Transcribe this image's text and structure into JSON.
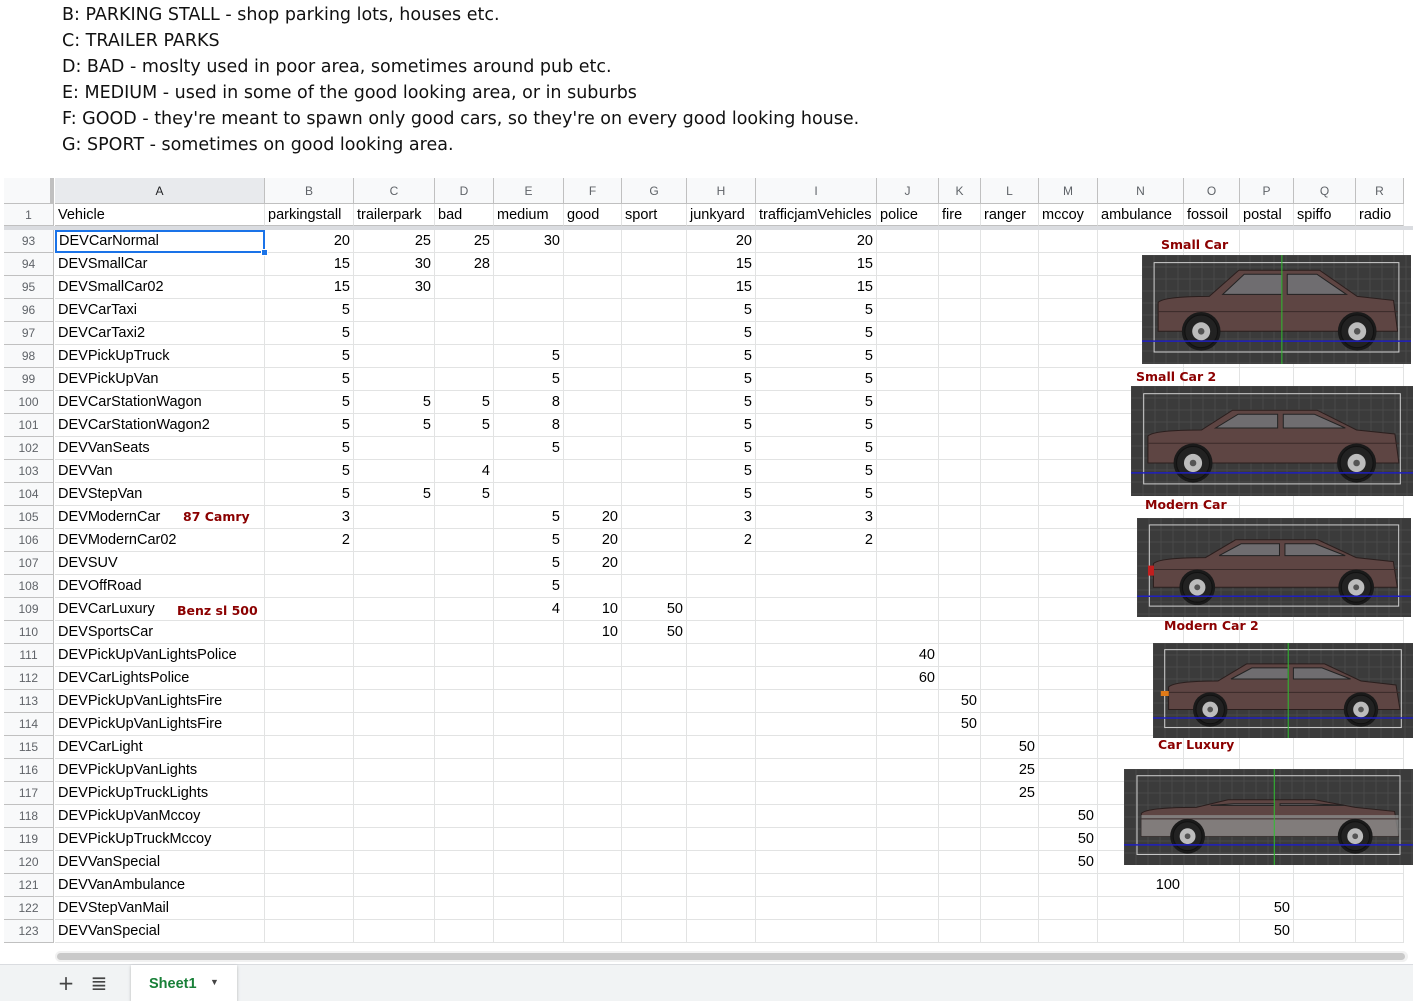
{
  "notes": [
    "B: PARKING STALL - shop parking lots, houses etc.",
    "C: TRAILER PARKS",
    "D: BAD - moslty used in poor area, sometimes around pub etc.",
    "E: MEDIUM - used in some of the good looking area, or in suburbs",
    "F: GOOD - they're meant to spawn only good cars, so they're on every good looking house.",
    "G: SPORT - sometimes on good looking area."
  ],
  "columns": [
    "A",
    "B",
    "C",
    "D",
    "E",
    "F",
    "G",
    "H",
    "I",
    "J",
    "K",
    "L",
    "M",
    "N",
    "O",
    "P",
    "Q",
    "R"
  ],
  "header_row": {
    "number": "1",
    "cells": [
      "Vehicle",
      "parkingstall",
      "trailerpark",
      "bad",
      "medium",
      "good",
      "sport",
      "junkyard",
      "trafficjamVehicles",
      "police",
      "fire",
      "ranger",
      "mccoy",
      "ambulance",
      "fossoil",
      "postal",
      "spiffo",
      "radio"
    ]
  },
  "rows": [
    {
      "n": "93",
      "cells": [
        "DEVCarNormal",
        "20",
        "25",
        "25",
        "30",
        "",
        "",
        "20",
        "20",
        "",
        "",
        "",
        "",
        "",
        "",
        "",
        "",
        ""
      ]
    },
    {
      "n": "94",
      "cells": [
        "DEVSmallCar",
        "15",
        "30",
        "28",
        "",
        "",
        "",
        "15",
        "15",
        "",
        "",
        "",
        "",
        "",
        "",
        "",
        "",
        ""
      ]
    },
    {
      "n": "95",
      "cells": [
        "DEVSmallCar02",
        "15",
        "30",
        "",
        "",
        "",
        "",
        "15",
        "15",
        "",
        "",
        "",
        "",
        "",
        "",
        "",
        "",
        ""
      ]
    },
    {
      "n": "96",
      "cells": [
        "DEVCarTaxi",
        "5",
        "",
        "",
        "",
        "",
        "",
        "5",
        "5",
        "",
        "",
        "",
        "",
        "",
        "",
        "",
        "",
        ""
      ]
    },
    {
      "n": "97",
      "cells": [
        "DEVCarTaxi2",
        "5",
        "",
        "",
        "",
        "",
        "",
        "5",
        "5",
        "",
        "",
        "",
        "",
        "",
        "",
        "",
        "",
        ""
      ]
    },
    {
      "n": "98",
      "cells": [
        "DEVPickUpTruck",
        "5",
        "",
        "",
        "5",
        "",
        "",
        "5",
        "5",
        "",
        "",
        "",
        "",
        "",
        "",
        "",
        "",
        ""
      ]
    },
    {
      "n": "99",
      "cells": [
        "DEVPickUpVan",
        "5",
        "",
        "",
        "5",
        "",
        "",
        "5",
        "5",
        "",
        "",
        "",
        "",
        "",
        "",
        "",
        "",
        ""
      ]
    },
    {
      "n": "100",
      "cells": [
        "DEVCarStationWagon",
        "5",
        "5",
        "5",
        "8",
        "",
        "",
        "5",
        "5",
        "",
        "",
        "",
        "",
        "",
        "",
        "",
        "",
        ""
      ]
    },
    {
      "n": "101",
      "cells": [
        "DEVCarStationWagon2",
        "5",
        "5",
        "5",
        "8",
        "",
        "",
        "5",
        "5",
        "",
        "",
        "",
        "",
        "",
        "",
        "",
        "",
        ""
      ]
    },
    {
      "n": "102",
      "cells": [
        "DEVVanSeats",
        "5",
        "",
        "",
        "5",
        "",
        "",
        "5",
        "5",
        "",
        "",
        "",
        "",
        "",
        "",
        "",
        "",
        ""
      ]
    },
    {
      "n": "103",
      "cells": [
        "DEVVan",
        "5",
        "",
        "4",
        "",
        "",
        "",
        "5",
        "5",
        "",
        "",
        "",
        "",
        "",
        "",
        "",
        "",
        ""
      ]
    },
    {
      "n": "104",
      "cells": [
        "DEVStepVan",
        "5",
        "5",
        "5",
        "",
        "",
        "",
        "5",
        "5",
        "",
        "",
        "",
        "",
        "",
        "",
        "",
        "",
        ""
      ]
    },
    {
      "n": "105",
      "cells": [
        "DEVModernCar",
        "3",
        "",
        "",
        "5",
        "20",
        "",
        "3",
        "3",
        "",
        "",
        "",
        "",
        "",
        "",
        "",
        "",
        ""
      ]
    },
    {
      "n": "106",
      "cells": [
        "DEVModernCar02",
        "2",
        "",
        "",
        "5",
        "20",
        "",
        "2",
        "2",
        "",
        "",
        "",
        "",
        "",
        "",
        "",
        "",
        ""
      ]
    },
    {
      "n": "107",
      "cells": [
        "DEVSUV",
        "",
        "",
        "",
        "5",
        "20",
        "",
        "",
        "",
        "",
        "",
        "",
        "",
        "",
        "",
        "",
        "",
        ""
      ]
    },
    {
      "n": "108",
      "cells": [
        "DEVOffRoad",
        "",
        "",
        "",
        "5",
        "",
        "",
        "",
        "",
        "",
        "",
        "",
        "",
        "",
        "",
        "",
        "",
        ""
      ]
    },
    {
      "n": "109",
      "cells": [
        "DEVCarLuxury",
        "",
        "",
        "",
        "4",
        "10",
        "50",
        "",
        "",
        "",
        "",
        "",
        "",
        "",
        "",
        "",
        "",
        ""
      ]
    },
    {
      "n": "110",
      "cells": [
        "DEVSportsCar",
        "",
        "",
        "",
        "",
        "10",
        "50",
        "",
        "",
        "",
        "",
        "",
        "",
        "",
        "",
        "",
        "",
        ""
      ]
    },
    {
      "n": "111",
      "cells": [
        "DEVPickUpVanLightsPolice",
        "",
        "",
        "",
        "",
        "",
        "",
        "",
        "",
        "40",
        "",
        "",
        "",
        "",
        "",
        "",
        "",
        ""
      ]
    },
    {
      "n": "112",
      "cells": [
        "DEVCarLightsPolice",
        "",
        "",
        "",
        "",
        "",
        "",
        "",
        "",
        "60",
        "",
        "",
        "",
        "",
        "",
        "",
        "",
        ""
      ]
    },
    {
      "n": "113",
      "cells": [
        "DEVPickUpVanLightsFire",
        "",
        "",
        "",
        "",
        "",
        "",
        "",
        "",
        "",
        "50",
        "",
        "",
        "",
        "",
        "",
        "",
        ""
      ]
    },
    {
      "n": "114",
      "cells": [
        "DEVPickUpVanLightsFire",
        "",
        "",
        "",
        "",
        "",
        "",
        "",
        "",
        "",
        "50",
        "",
        "",
        "",
        "",
        "",
        "",
        ""
      ]
    },
    {
      "n": "115",
      "cells": [
        "DEVCarLight",
        "",
        "",
        "",
        "",
        "",
        "",
        "",
        "",
        "",
        "",
        "50",
        "",
        "",
        "",
        "",
        "",
        ""
      ]
    },
    {
      "n": "116",
      "cells": [
        "DEVPickUpVanLights",
        "",
        "",
        "",
        "",
        "",
        "",
        "",
        "",
        "",
        "",
        "25",
        "",
        "",
        "",
        "",
        "",
        ""
      ]
    },
    {
      "n": "117",
      "cells": [
        "DEVPickUpTruckLights",
        "",
        "",
        "",
        "",
        "",
        "",
        "",
        "",
        "",
        "",
        "25",
        "",
        "",
        "",
        "",
        "",
        ""
      ]
    },
    {
      "n": "118",
      "cells": [
        "DEVPickUpVanMccoy",
        "",
        "",
        "",
        "",
        "",
        "",
        "",
        "",
        "",
        "",
        "",
        "50",
        "",
        "",
        "",
        "",
        ""
      ]
    },
    {
      "n": "119",
      "cells": [
        "DEVPickUpTruckMccoy",
        "",
        "",
        "",
        "",
        "",
        "",
        "",
        "",
        "",
        "",
        "",
        "50",
        "",
        "",
        "",
        "",
        ""
      ]
    },
    {
      "n": "120",
      "cells": [
        "DEVVanSpecial",
        "",
        "",
        "",
        "",
        "",
        "",
        "",
        "",
        "",
        "",
        "",
        "50",
        "",
        "",
        "",
        "",
        ""
      ]
    },
    {
      "n": "121",
      "cells": [
        "DEVVanAmbulance",
        "",
        "",
        "",
        "",
        "",
        "",
        "",
        "",
        "",
        "",
        "",
        "",
        "100",
        "",
        "",
        "",
        ""
      ]
    },
    {
      "n": "122",
      "cells": [
        "DEVStepVanMail",
        "",
        "",
        "",
        "",
        "",
        "",
        "",
        "",
        "",
        "",
        "",
        "",
        "",
        "",
        "50",
        "",
        ""
      ]
    },
    {
      "n": "123",
      "cells": [
        "DEVVanSpecial",
        "",
        "",
        "",
        "",
        "",
        "",
        "",
        "",
        "",
        "",
        "",
        "",
        "",
        "",
        "50",
        "",
        ""
      ]
    }
  ],
  "annotations": {
    "camry": "87 Camry",
    "benz": "Benz sl 500",
    "small_car": "Small Car",
    "small_car_2": "Small Car 2",
    "modern_car": "Modern Car",
    "modern_car_2": "Modern Car 2",
    "car_luxury": "Car Luxury"
  },
  "car_images": [
    "small-car-side-view",
    "small-car-2-side-view",
    "modern-car-side-view",
    "modern-car-2-side-view",
    "car-luxury-side-view"
  ],
  "colors": {
    "selection": "#1a73e8",
    "annotation": "#8b0000",
    "tab_text": "#188038",
    "car_body": "#5e4543"
  },
  "bottom_bar": {
    "sheet_tab": "Sheet1",
    "add_icon": "plus-icon",
    "list_icon": "all-sheets-icon"
  }
}
